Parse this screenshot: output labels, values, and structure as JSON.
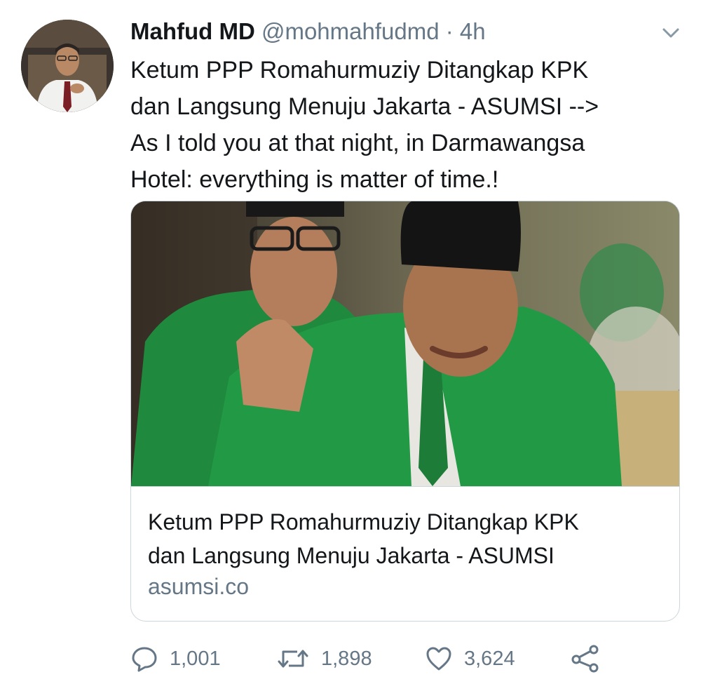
{
  "tweet": {
    "author_name": "Mahfud MD",
    "handle": "@mohmahfudmd",
    "separator": "·",
    "time": "4h",
    "text_lines": [
      "Ketum PPP Romahurmuziy Ditangkap KPK",
      "dan Langsung Menuju Jakarta - ASUMSI -->",
      "As I told you at that night, in Darmawangsa",
      "Hotel: everything is matter of time.!"
    ]
  },
  "card": {
    "title_lines": [
      "Ketum PPP Romahurmuziy Ditangkap KPK",
      "dan Langsung Menuju Jakarta - ASUMSI"
    ],
    "domain": "asumsi.co"
  },
  "actions": {
    "reply_count": "1,001",
    "retweet_count": "1,898",
    "like_count": "3,624"
  },
  "icons": {
    "reply": "speech-bubble-icon",
    "retweet": "retweet-arrows-icon",
    "like": "heart-icon",
    "share": "share-icon",
    "more": "chevron-down-icon"
  },
  "colors": {
    "text": "#14171a",
    "secondary": "#657786",
    "border": "#ccd6dd"
  }
}
